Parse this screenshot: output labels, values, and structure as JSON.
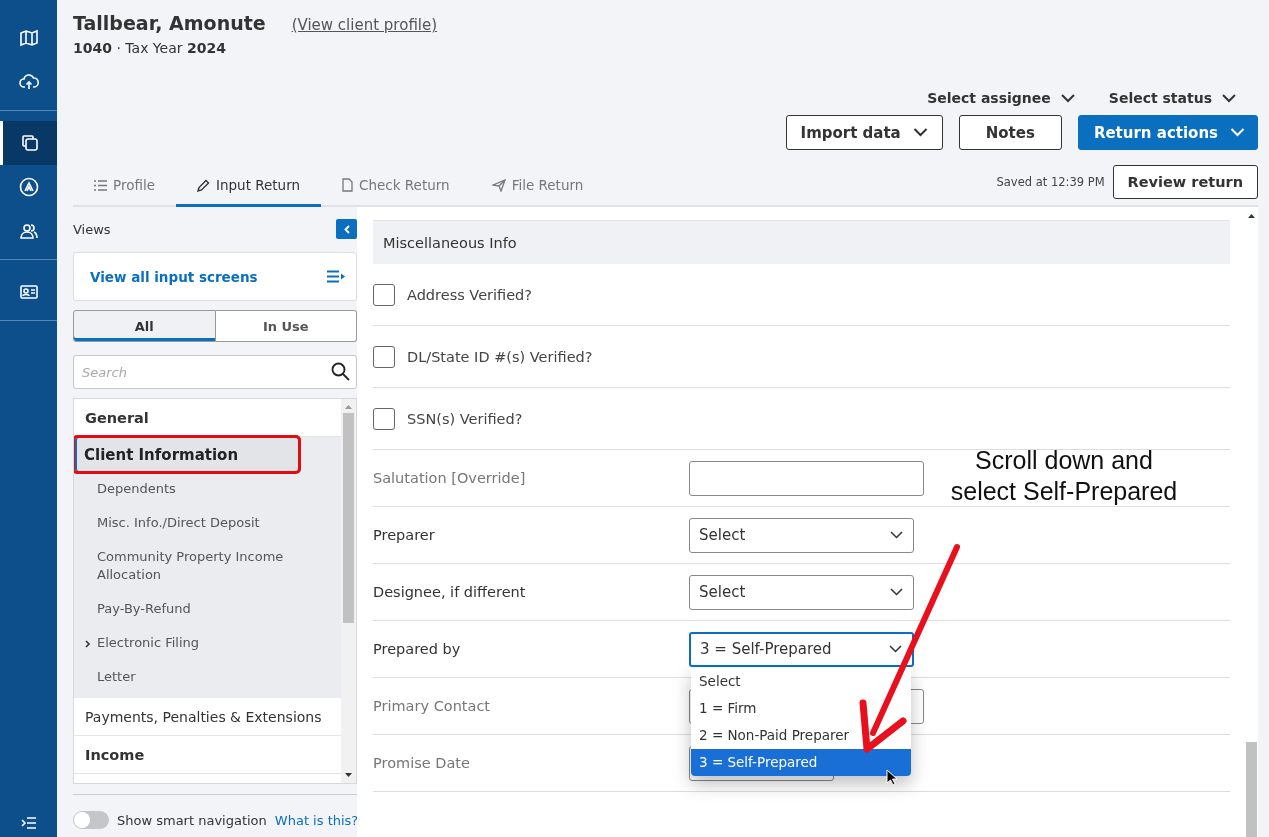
{
  "rail": {
    "items": [
      {
        "kind": "map",
        "selected": false
      },
      {
        "kind": "cloud",
        "selected": false
      },
      {
        "kind": "copy",
        "selected": true
      },
      {
        "kind": "logo",
        "selected": false
      },
      {
        "kind": "people",
        "selected": false
      },
      {
        "kind": "contact",
        "selected": false
      }
    ],
    "bottom": {
      "kind": "expand"
    }
  },
  "header": {
    "client_name": "Tallbear, Amonute",
    "profile_link": "(View client profile)",
    "subtitle": "**1040** · Tax Year **2024**",
    "assignee": "Select assignee",
    "status": "Select status",
    "buttons": [
      {
        "label": "Import data",
        "kind": "dropdown"
      },
      {
        "label": "Notes",
        "kind": "plain"
      },
      {
        "label": "Return actions",
        "kind": "primary"
      }
    ],
    "saved": "Saved at 12:39 PM",
    "review_button": "Review return"
  },
  "tabs": [
    {
      "label": "Profile",
      "selected": false
    },
    {
      "label": "Input Return",
      "selected": true
    },
    {
      "label": "Check Return",
      "selected": false
    },
    {
      "label": "File Return",
      "selected": false
    }
  ],
  "sidebar": {
    "title": "Views",
    "view_all": "View all input screens",
    "filters": [
      {
        "label": "All",
        "selected": true
      },
      {
        "label": "In Use",
        "selected": false
      }
    ],
    "search": {
      "placeholder": "Search"
    },
    "tree": [
      {
        "label": "General",
        "bold": true,
        "expanded": true,
        "children": [
          {
            "label": "Client Information",
            "selected": true,
            "annotated": true
          },
          {
            "label": "Dependents",
            "selected": false,
            "annotated": false
          },
          {
            "label": "Misc. Info./Direct Deposit",
            "selected": false,
            "annotated": false
          },
          {
            "label": "Community Property Income Allocation",
            "selected": false,
            "annotated": false
          },
          {
            "label": "Pay-By-Refund",
            "selected": false,
            "annotated": false
          },
          {
            "label": "Electronic Filing",
            "selected": false,
            "annotated": false,
            "expanded": false
          },
          {
            "label": "Letter",
            "selected": false,
            "annotated": false
          }
        ]
      },
      {
        "label": "Payments, Penalties & Extensions",
        "bold": false
      },
      {
        "label": "Income",
        "bold": true
      }
    ],
    "smart_nav": {
      "label": "Show smart navigation",
      "on": false,
      "link": "What is this?"
    }
  },
  "form": {
    "section": "Miscellaneous Info",
    "checks": [
      {
        "label": "Address Verified?",
        "checked": false
      },
      {
        "label": "DL/State ID #(s) Verified?",
        "checked": false
      },
      {
        "label": "SSN(s) Verified?",
        "checked": false
      }
    ],
    "fields": [
      {
        "label": "Salutation [Override]",
        "kind": "text"
      },
      {
        "label": "Preparer",
        "kind": "select",
        "value": "Select"
      },
      {
        "label": "Designee, if different",
        "kind": "select",
        "value": "Select"
      },
      {
        "label": "Prepared by",
        "kind": "select",
        "value": "3 = Self-Prepared",
        "open": true,
        "options": [
          {
            "label": "Select",
            "selected": false
          },
          {
            "label": "1 = Firm",
            "selected": false
          },
          {
            "label": "2 = Non-Paid Preparer",
            "selected": false
          },
          {
            "label": "3 = Self-Prepared",
            "selected": true
          }
        ]
      },
      {
        "label": "Primary Contact",
        "kind": "text"
      },
      {
        "label": "Promise Date",
        "kind": "date"
      }
    ]
  },
  "callout": {
    "text": "Scroll down and select Self-Prepared"
  }
}
